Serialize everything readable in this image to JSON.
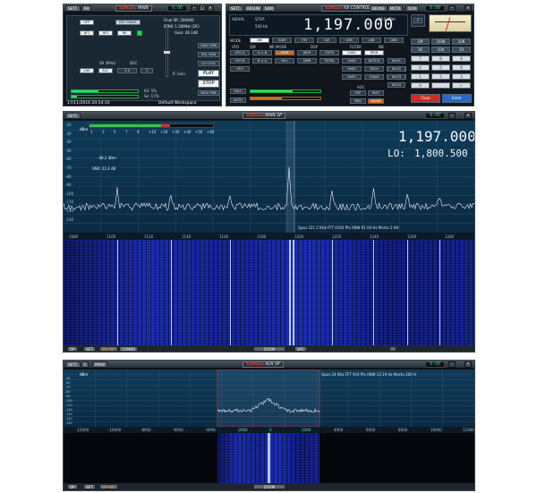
{
  "colors": {
    "accent": "#d46a12",
    "spectrum_bg": "#0f3a58",
    "waterfall": "#1b2aa0",
    "clock": "#3ad86a"
  },
  "main_window": {
    "title": "MAIN",
    "btns": [
      "SETT.",
      "RA"
    ],
    "clock": "0:00",
    "opt": "OPT",
    "rec_panel": "REC PANEL",
    "af": [
      "AF1",
      "AF2",
      "RA"
    ],
    "final_sr": "Final SR: 200000",
    "ifbw": "IFBW: 1.50MHz (DF)",
    "gain": "Gain: 46.1dB",
    "sr_label": "SR (MHz)",
    "dec_label": "DEC",
    "sr_btns": [
      "LNA",
      "AGC",
      "2.0",
      "1"
    ],
    "if_gain": "IF Gain",
    "side": [
      "GAIN VBW",
      "DSL VBW",
      "LO LOCK"
    ],
    "play": "PLAY",
    "stop": "STOP",
    "new": "NEW FWA",
    "lev": [
      "64: 5%",
      "Se: 17%"
    ],
    "date": "17/11/2016 20:14:10",
    "workspace": "Default Workspace"
  },
  "rx_window": {
    "title": "RX CONTROL",
    "btns": [
      "SETT.",
      "RESUM",
      "SAM"
    ],
    "right_btns": [
      "BEVN2",
      "MCTR",
      "SCM"
    ],
    "clock": "0:00",
    "aerial": "AERIAL",
    "step": "STEP:",
    "step_val": "500 Hz",
    "freq": "1,197.000",
    "dbm": "-48.2 dBm",
    "s_meter": "S",
    "mode_label": "MODE",
    "modes": [
      "AM",
      "SAM",
      "FM",
      "CW",
      "USB",
      "LSB",
      "DSB"
    ],
    "vfo_label": "VFO",
    "qm_label": "QM",
    "nr_label": "NR MODE",
    "dsp_label": "DSP",
    "filter_label": "FILTER",
    "nb_label": "NB",
    "row2": [
      "VFO A",
      "A > B",
      "NFM",
      "WFM",
      "CNTR",
      "2000",
      "RFIN"
    ],
    "row3": [
      "VFO B",
      "B > A",
      "NXL",
      "DMR",
      "TETRA",
      "4000",
      "NOTCH"
    ],
    "row4": [
      "VFO",
      "",
      "",
      "",
      "",
      "6000",
      "SRCH",
      "NCH1"
    ],
    "row5": [
      "",
      "",
      "",
      "",
      "",
      "8000",
      "10000",
      "NCH2"
    ],
    "agc_label": "AGC",
    "agc": [
      "SQLC",
      "",
      "",
      "OFF",
      "FAST",
      "NCH3"
    ],
    "auto": [
      "AUTO",
      "",
      "",
      "",
      "MED",
      "SLOW",
      "NCH4"
    ],
    "keys": [
      "7",
      "8",
      "9",
      "4",
      "5",
      "6",
      "1",
      "2",
      "3",
      "0",
      ".",
      "←"
    ],
    "keys_top": [
      "1M",
      "100K",
      "10K",
      "1K",
      "100",
      "10"
    ],
    "clear": "Clear",
    "enter": "Enter",
    "nch": [
      "NCH1",
      "NCH2",
      "NCH3",
      "NCH4"
    ]
  },
  "main_sp": {
    "title": "MAIN SP",
    "btns": [
      "SETT."
    ],
    "clock": "0:00",
    "unit": "dBm",
    "db_ticks": [
      "-20",
      "-30",
      "-40",
      "-50",
      "-60",
      "-70",
      "-80",
      "-90",
      "-100",
      "-110",
      "-120",
      "-130"
    ],
    "bar_ticks": [
      "1",
      "3",
      "5",
      "7",
      "9",
      "+10",
      "+20",
      "+30",
      "+40",
      "+50",
      "+60"
    ],
    "level": "-48.2 dBm",
    "snr": "SNR: 22.4 dB",
    "freq": "1,197.000",
    "lo_label": "LO:",
    "lo": "1,800.500",
    "info": "Span 221.5 KHz  FFT 8192 Pts  RBW 61.04 Hz  Marks 2 KH",
    "freq_ticks": [
      "1080",
      "1100",
      "1120",
      "1140",
      "1160",
      "1180",
      "1200",
      "1220",
      "1240",
      "1260",
      "1280"
    ],
    "bottom": [
      "DP",
      "SET",
      "SP+WF",
      "COMBO"
    ],
    "zoom": "ZOOM",
    "spc": "SPC"
  },
  "aux_sp": {
    "title": "AUX SP",
    "btns": [
      "SETT.",
      "F",
      "PMAP"
    ],
    "clock": "0:00",
    "unit": "dBm",
    "db_ticks": [
      "-50",
      "-60",
      "-70",
      "-80",
      "-90",
      "-100",
      "-110",
      "-120",
      "-130",
      "-140",
      "-150"
    ],
    "info": "Span 24 KHz  FFT 910 Pts  RBW 13.19 Hz  Marks 200 H",
    "freq_ticks": [
      "-12000",
      "-10000",
      "-8000",
      "-6000",
      "-4000",
      "-2000",
      "0",
      "2000",
      "4000",
      "6000",
      "8000",
      "10000",
      "12000"
    ],
    "bottom": [
      "DP",
      "SET",
      "SP+WF"
    ],
    "zoom": "ZOOM"
  }
}
